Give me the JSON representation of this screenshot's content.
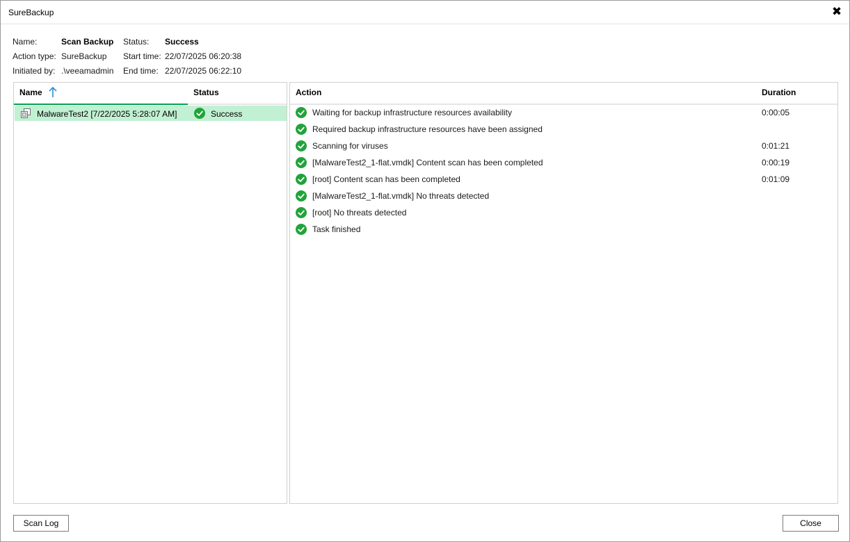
{
  "window": {
    "title": "SureBackup"
  },
  "info": {
    "name_label": "Name:",
    "name_value": "Scan Backup",
    "action_type_label": "Action type:",
    "action_type_value": "SureBackup",
    "initiated_by_label": "Initiated by:",
    "initiated_by_value": ".\\veeamadmin",
    "status_label": "Status:",
    "status_value": "Success",
    "start_time_label": "Start time:",
    "start_time_value": "22/07/2025 06:20:38",
    "end_time_label": "End time:",
    "end_time_value": "22/07/2025 06:22:10"
  },
  "objects_table": {
    "columns": {
      "name": "Name",
      "status": "Status"
    },
    "sort_icon": "sort-ascending-arrow-icon",
    "rows": [
      {
        "name": "MalwareTest2 [7/22/2025 5:28:07 AM]",
        "status": "Success",
        "icon": "vm-icon",
        "selected": true
      }
    ]
  },
  "actions_table": {
    "columns": {
      "action": "Action",
      "duration": "Duration"
    },
    "rows": [
      {
        "action": "Waiting for backup infrastructure resources availability",
        "duration": "0:00:05"
      },
      {
        "action": "Required backup infrastructure resources have been assigned",
        "duration": ""
      },
      {
        "action": "Scanning for viruses",
        "duration": "0:01:21"
      },
      {
        "action": "[MalwareTest2_1-flat.vmdk] Content scan has been completed",
        "duration": "0:00:19"
      },
      {
        "action": "[root] Content scan has been completed",
        "duration": "0:01:09"
      },
      {
        "action": "[MalwareTest2_1-flat.vmdk] No threats detected",
        "duration": ""
      },
      {
        "action": "[root] No threats detected",
        "duration": ""
      },
      {
        "action": "Task finished",
        "duration": ""
      }
    ]
  },
  "buttons": {
    "scan_log": "Scan Log",
    "close": "Close"
  },
  "colors": {
    "success_green": "#21a33a",
    "selection_bg": "#c1f0d3",
    "sort_arrow": "#2b8fd6",
    "sort_underline": "#00a34a"
  }
}
